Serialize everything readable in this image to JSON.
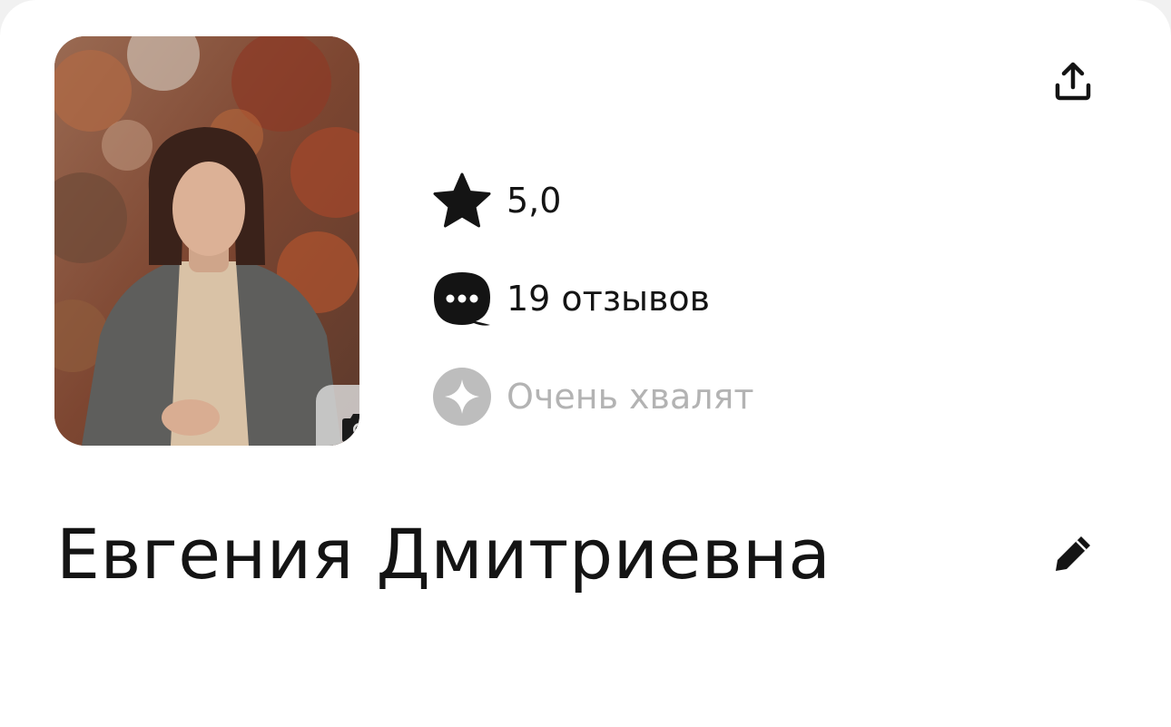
{
  "profile": {
    "name": "Евгения Дмитриевна",
    "rating": "5,0",
    "reviews": "19 отзывов",
    "praise": "Очень хвалят"
  },
  "icons": {
    "share": "share-upload-icon",
    "camera": "camera-icon",
    "star": "star-icon",
    "reviews": "chat-bubble-dots-icon",
    "praise": "sparkle-icon",
    "edit": "pencil-icon"
  },
  "colors": {
    "text": "#141414",
    "muted": "#b3b3b3",
    "icon": "#141414",
    "praise_icon_bg": "#bdbdbd",
    "background": "#ffffff"
  }
}
